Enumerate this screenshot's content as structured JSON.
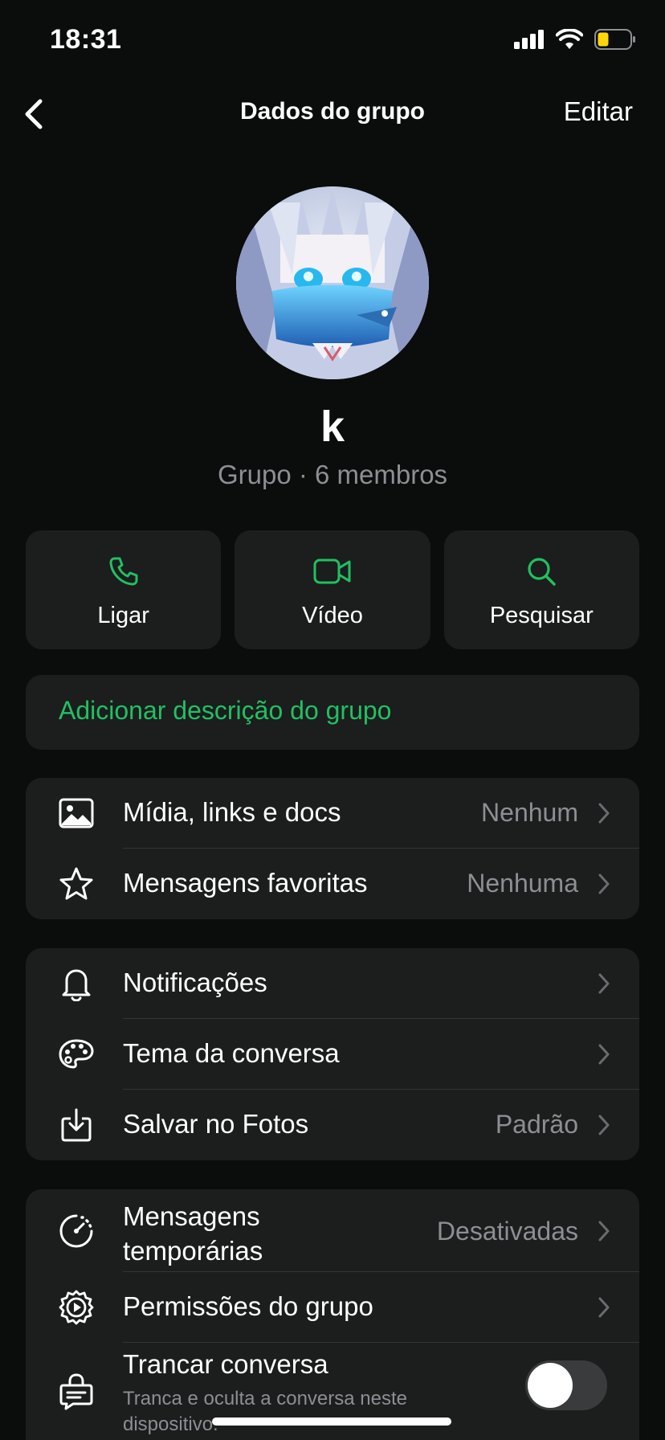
{
  "status_bar": {
    "time": "18:31",
    "battery_color": "#ffd60a"
  },
  "nav": {
    "title": "Dados do grupo",
    "edit_label": "Editar"
  },
  "group": {
    "name": "k",
    "subtitle": "Grupo · 6 membros"
  },
  "actions": [
    {
      "label": "Ligar",
      "icon": "phone-icon"
    },
    {
      "label": "Vídeo",
      "icon": "video-camera-icon"
    },
    {
      "label": "Pesquisar",
      "icon": "search-icon"
    }
  ],
  "description": {
    "add_label": "Adicionar descrição do grupo"
  },
  "section_media": {
    "items": [
      {
        "label": "Mídia, links e docs",
        "value": "Nenhum",
        "icon": "image-icon"
      },
      {
        "label": "Mensagens favoritas",
        "value": "Nenhuma",
        "icon": "star-icon"
      }
    ]
  },
  "section_settings": {
    "items": [
      {
        "label": "Notificações",
        "value": "",
        "icon": "bell-icon"
      },
      {
        "label": "Tema da conversa",
        "value": "",
        "icon": "palette-icon"
      },
      {
        "label": "Salvar no Fotos",
        "value": "Padrão",
        "icon": "save-download-icon"
      }
    ]
  },
  "section_privacy": {
    "items": [
      {
        "label": "Mensagens temporárias",
        "label_line1": "Mensagens",
        "label_line2": "temporárias",
        "value": "Desativadas",
        "icon": "timer-icon"
      },
      {
        "label": "Permissões do grupo",
        "value": "",
        "icon": "gear-play-icon"
      },
      {
        "label": "Trancar conversa",
        "sublabel": "Tranca e oculta a conversa neste dispositivo.",
        "toggle": false,
        "icon": "lock-chat-icon"
      }
    ]
  },
  "colors": {
    "accent": "#21c063",
    "background": "#0b0c0c",
    "card": "#1c1d1d",
    "secondary_text": "#8e8e93"
  }
}
